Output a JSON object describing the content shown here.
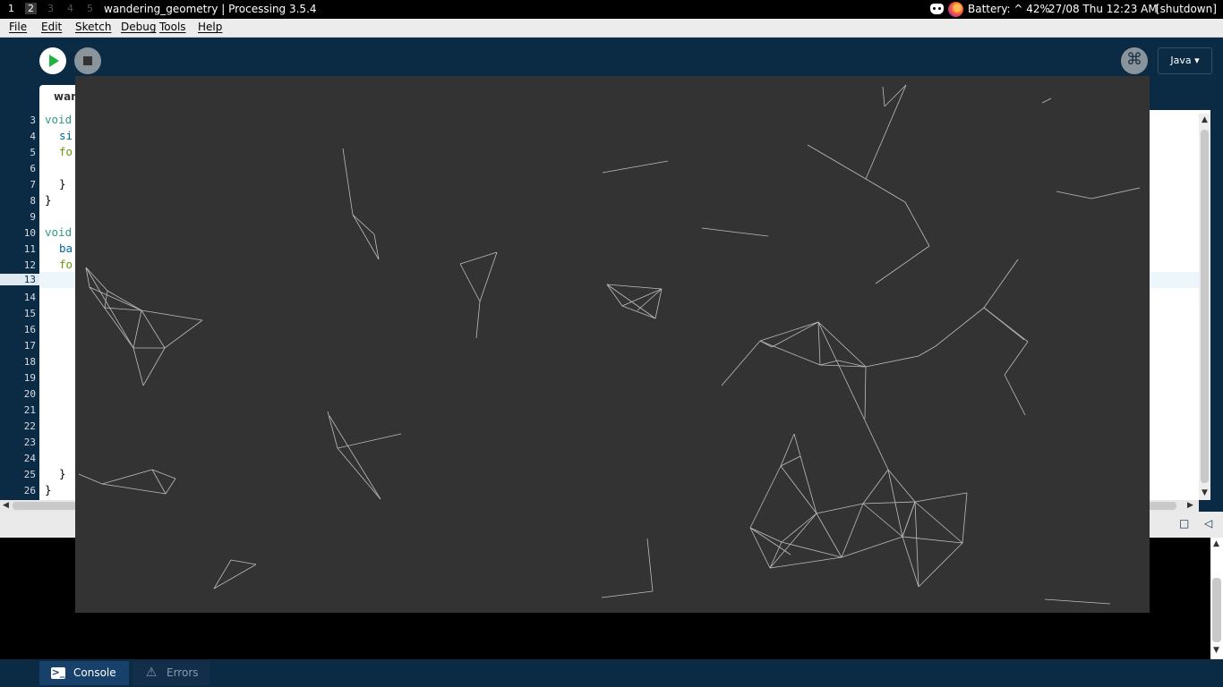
{
  "topbar": {
    "workspaces": [
      "1",
      "2",
      "3",
      "4",
      "5"
    ],
    "active_workspace": "2",
    "window_title": "wandering_geometry | Processing 3.5.4",
    "battery": "Battery: ^ 42%",
    "datetime": "27/08 Thu 12:23 AM",
    "shutdown": "[shutdown]"
  },
  "menubar": {
    "items": [
      "File",
      "Edit",
      "Sketch",
      "Debug",
      "Tools",
      "Help"
    ]
  },
  "toolbar": {
    "mode": "Java ▾"
  },
  "editor": {
    "tab_label": "wan",
    "line_numbers": [
      "3",
      "4",
      "5",
      "6",
      "7",
      "8",
      "9",
      "10",
      "11",
      "12",
      "13",
      "14",
      "15",
      "16",
      "17",
      "18",
      "19",
      "20",
      "21",
      "22",
      "23",
      "24",
      "25",
      "26"
    ],
    "current_line": "13",
    "code": {
      "l3": "void",
      "l4": "si",
      "l5": "fo",
      "l7": "}",
      "l8": "}",
      "l10": "void",
      "l11": "ba",
      "l12": "fo",
      "l25": "}",
      "l26": "}"
    }
  },
  "console": {
    "tabs": [
      "Console",
      "Errors"
    ],
    "controls": [
      "□",
      "◁"
    ]
  },
  "colors": {
    "ide_bg": "#0b2a44",
    "sketch_bg": "#333333",
    "run_green": "#1fb53d"
  }
}
